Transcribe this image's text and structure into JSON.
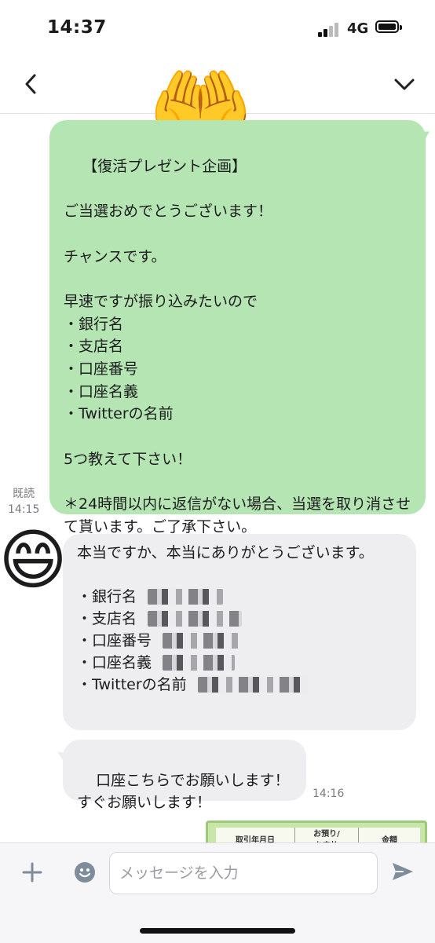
{
  "status_bar": {
    "time": "14:37",
    "network": "4G"
  },
  "header": {
    "title_icon": "raised-hands-emoji"
  },
  "messages": {
    "outgoing": {
      "text": "【復活プレゼント企画】\n\nご当選おめでとうございます！\n\nチャンスです。\n\n早速ですが振り込みたいので\n・銀行名\n・支店名\n・口座番号\n・口座名義\n・Twitterの名前\n\n5つ教えて下さい！\n\n＊24時間以内に返信がない場合、当選を取り消させて貰います。ご了承下さい。",
      "read_label": "既読",
      "time": "14:15"
    },
    "incoming_1": {
      "avatar": "grinning-face-emoji",
      "text": "本当ですか、本当にありがとうございます。",
      "items": [
        "・銀行名",
        "・支店名",
        "・口座番号",
        "・口座名義",
        "・Twitterの名前"
      ]
    },
    "incoming_2": {
      "text": "口座こちらでお願いします！\nすぐお願いします！",
      "time": "14:16"
    },
    "image_preview": {
      "col1": "取引年月日",
      "col2": "お預り/\nお支払",
      "col3": "金額"
    }
  },
  "input_bar": {
    "placeholder": "メッセージを入力"
  },
  "colors": {
    "outgoing_bubble": "#b5e5b3",
    "incoming_bubble": "#eeeef1",
    "accent": "#7f8c9b"
  }
}
